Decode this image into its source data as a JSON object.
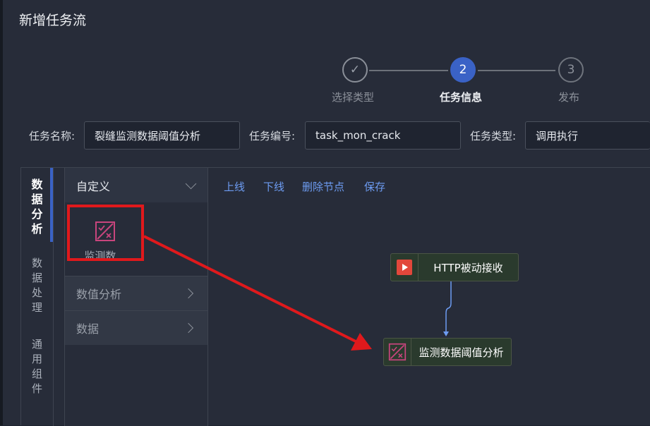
{
  "dialog": {
    "title": "新增任务流"
  },
  "steps": [
    {
      "number": "✓",
      "label": "选择类型",
      "state": "done"
    },
    {
      "number": "2",
      "label": "任务信息",
      "state": "active"
    },
    {
      "number": "3",
      "label": "发布",
      "state": "todo"
    }
  ],
  "form": {
    "name_label": "任务名称:",
    "name_value": "裂缝监测数据阈值分析",
    "code_label": "任务编号:",
    "code_value": "task_mon_crack",
    "type_label": "任务类型:",
    "type_value": "调用执行"
  },
  "vertical_tabs": [
    {
      "label": "数据分析",
      "active": true
    },
    {
      "label": "数据处理",
      "active": false
    },
    {
      "label": "通用组件",
      "active": false
    }
  ],
  "categories": {
    "header": "自定义",
    "tile_label": "监测数...",
    "items": [
      "数值分析",
      "数据"
    ]
  },
  "toolbar": {
    "online": "上线",
    "offline": "下线",
    "delete_node": "删除节点",
    "save": "保存"
  },
  "canvas": {
    "node_http": "HTTP被动接收",
    "node_analysis": "监测数据阈值分析"
  },
  "colors": {
    "accent": "#3a62c6",
    "link": "#6d9cf2",
    "highlight": "#e0191c",
    "node_bg": "#2a3a2d"
  }
}
